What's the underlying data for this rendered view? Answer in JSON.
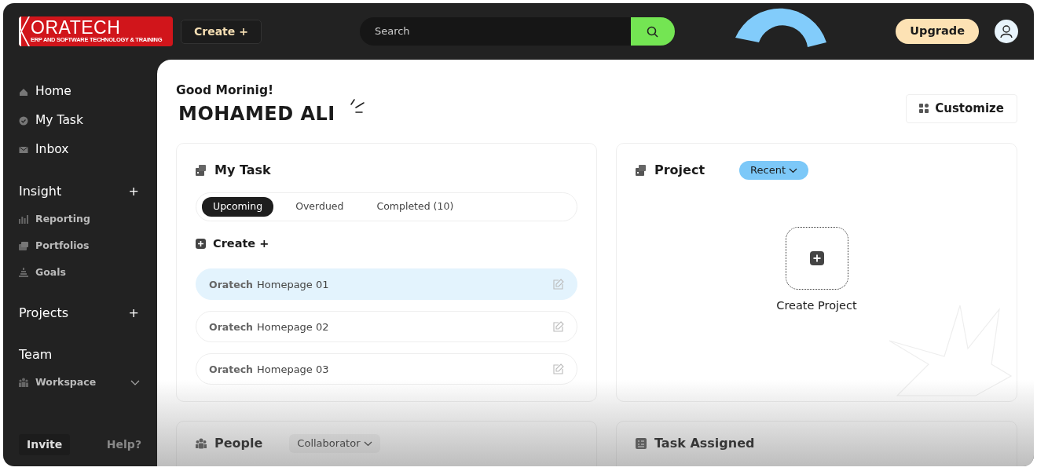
{
  "header": {
    "logo": {
      "name": "ORATECH",
      "tagline": "ERP AND SOFTWARE TECHNOLOGY & TRAINING"
    },
    "create_button": "Create +",
    "search": {
      "placeholder": "Search"
    },
    "upgrade_button": "Upgrade"
  },
  "sidebar": {
    "items": [
      {
        "label": "Home",
        "kind": "main"
      },
      {
        "label": "My Task",
        "kind": "main"
      },
      {
        "label": "Inbox",
        "kind": "main"
      },
      {
        "label": "Insight",
        "kind": "section",
        "action": "+"
      },
      {
        "label": "Reporting",
        "kind": "sub"
      },
      {
        "label": "Portfolios",
        "kind": "sub"
      },
      {
        "label": "Goals",
        "kind": "sub"
      },
      {
        "label": "Projects",
        "kind": "section",
        "action": "+"
      },
      {
        "label": "Team",
        "kind": "section"
      },
      {
        "label": "Workspace",
        "kind": "sub",
        "expanded": false
      }
    ],
    "invite_button": "Invite",
    "help_link": "Help?"
  },
  "main": {
    "greeting": "Good Morinig!",
    "user_name": "MOHAMED ALI",
    "customize_button": "Customize",
    "my_task": {
      "title": "My Task",
      "tabs": [
        {
          "label": "Upcoming",
          "selected": true
        },
        {
          "label": "Overdued",
          "selected": false
        },
        {
          "label": "Completed (10)",
          "selected": false
        }
      ],
      "create_button": "Create +",
      "tasks": [
        {
          "prefix": "Oratech",
          "title": "Homepage 01",
          "selected": true
        },
        {
          "prefix": "Oratech",
          "title": "Homepage 02",
          "selected": false
        },
        {
          "prefix": "Oratech",
          "title": "Homepage 03",
          "selected": false
        }
      ]
    },
    "project": {
      "title": "Project",
      "filter": "Recent",
      "create_label": "Create Project"
    },
    "people": {
      "title": "People",
      "filter": "Collaborator"
    },
    "task_assigned": {
      "title": "Task Assigned"
    }
  }
}
